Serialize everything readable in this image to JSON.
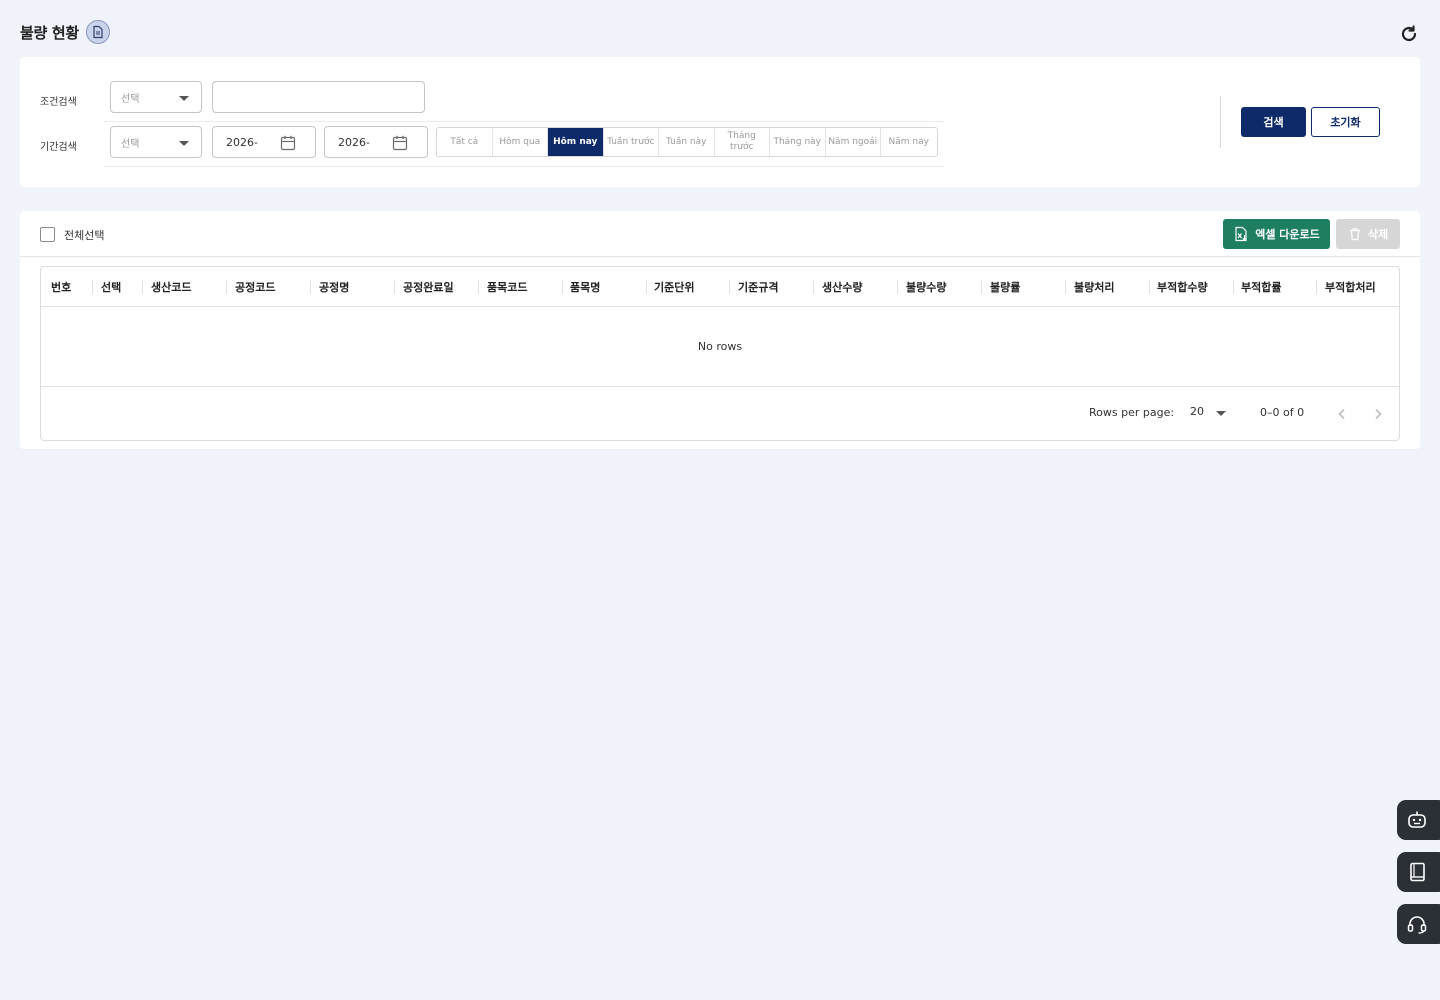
{
  "page": {
    "title": "불량 현황"
  },
  "search": {
    "condition_label": "조건검색",
    "period_label": "기간검색",
    "condition_select_placeholder": "선택",
    "period_select_placeholder": "선택",
    "keyword_value": "",
    "date_from": "2026-",
    "date_to": "2026-",
    "periods": [
      {
        "label": "Tất cả",
        "active": false
      },
      {
        "label": "Hôm qua",
        "active": false
      },
      {
        "label": "Hôm nay",
        "active": true
      },
      {
        "label": "Tuần trước",
        "active": false
      },
      {
        "label": "Tuần này",
        "active": false
      },
      {
        "label": "Tháng trước",
        "active": false
      },
      {
        "label": "Tháng này",
        "active": false
      },
      {
        "label": "Năm ngoái",
        "active": false
      },
      {
        "label": "Năm nay",
        "active": false
      }
    ],
    "search_button": "검색",
    "reset_button": "초기화"
  },
  "grid": {
    "select_all_label": "전체선택",
    "excel_button": "엑셀 다운로드",
    "delete_button": "삭제",
    "columns": [
      "번호",
      "선택",
      "생산코드",
      "공정코드",
      "공정명",
      "공정완료일",
      "품목코드",
      "품목명",
      "기준단위",
      "기준규격",
      "생산수량",
      "불량수량",
      "불량률",
      "불량처리",
      "부적합수량",
      "부적합률",
      "부적합처리"
    ],
    "empty_text": "No rows",
    "rows_per_page_label": "Rows per page:",
    "rows_per_page": "20",
    "page_range": "0–0 of 0"
  },
  "colors": {
    "primary": "#0f2a68",
    "excel": "#1e7e61",
    "background": "#f0f3fa",
    "side_button": "#2b2f36"
  },
  "icons": {
    "title": "document-icon",
    "refresh": "refresh-icon",
    "calendar": "calendar-icon",
    "excel": "excel-file-icon",
    "delete": "trash-icon",
    "side": [
      "chatbot-icon",
      "manual-book-icon",
      "headset-support-icon"
    ]
  }
}
